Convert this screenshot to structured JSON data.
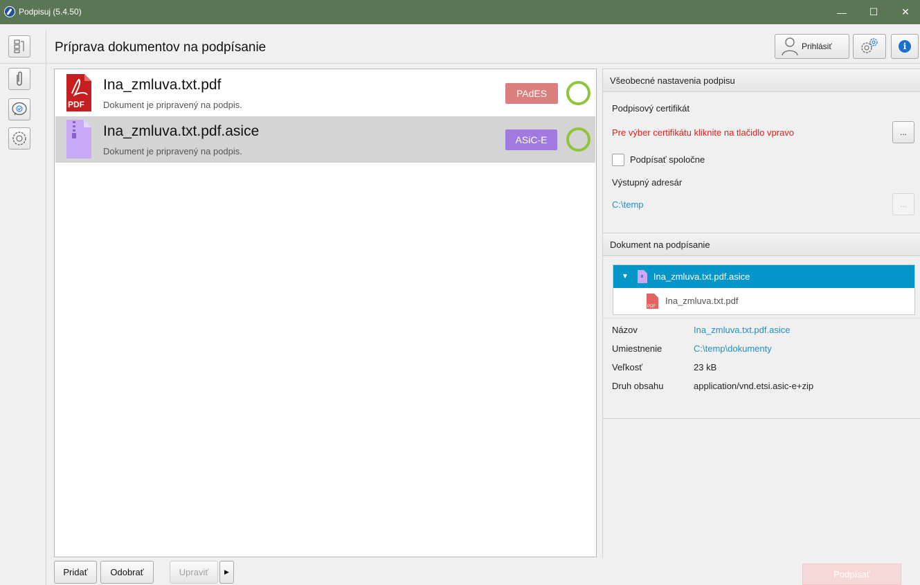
{
  "window": {
    "title": "Podpisuj (5.4.50)",
    "minimize_glyph": "—",
    "maximize_glyph": "☐",
    "close_glyph": "✕"
  },
  "header": {
    "page_title": "Príprava dokumentov na podpísanie",
    "login_label": "Prihlásiť",
    "info_glyph": "i"
  },
  "documents": [
    {
      "name": "Ina_zmluva.txt.pdf",
      "status": "Dokument je pripravený na podpis.",
      "badge": "PAdES",
      "badge_color": "#db7e7e",
      "icon": "pdf-file-icon",
      "icon_label": "PDF"
    },
    {
      "name": "Ina_zmluva.txt.pdf.asice",
      "status": "Dokument je pripravený na podpis.",
      "badge": "ASiC-E",
      "badge_color": "#a07ae0",
      "icon": "asice-archive-icon"
    }
  ],
  "bottom": {
    "add": "Pridať",
    "remove": "Odobrať",
    "edit": "Upraviť",
    "more": "▶",
    "sign": "Podpísať"
  },
  "settings": {
    "section_title": "Všeobecné nastavenia podpisu",
    "cert_label": "Podpisový certifikát",
    "cert_hint": "Pre výber certifikátu kliknite na tlačidlo vpravo",
    "dots": "...",
    "sign_together": "Podpísať spoločne",
    "output_label": "Výstupný adresár",
    "output_path": "C:\\temp"
  },
  "document_section": {
    "title": "Dokument na podpísanie",
    "tree": [
      {
        "name": "Ina_zmluva.txt.pdf.asice",
        "expander": "▼"
      },
      {
        "name": "Ina_zmluva.txt.pdf",
        "icon_label": "PDF"
      }
    ],
    "meta": [
      {
        "key": "Názov",
        "value": "Ina_zmluva.txt.pdf.asice",
        "link": true
      },
      {
        "key": "Umiestnenie",
        "value": "C:\\temp\\dokumenty",
        "link": true
      },
      {
        "key": "Veľkosť",
        "value": "23 kB",
        "link": false
      },
      {
        "key": "Druh obsahu",
        "value": "application/vnd.etsi.asic-e+zip",
        "link": false
      }
    ]
  },
  "colors": {
    "titlebar": "#5b7654",
    "accent_blue": "#0596c9",
    "link": "#1f8ec9",
    "error": "#e81b1b",
    "ring": "#8fc43c"
  }
}
